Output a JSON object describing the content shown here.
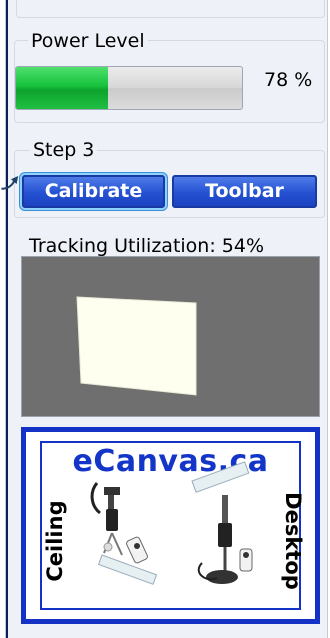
{
  "power": {
    "legend": "Power Level",
    "fraction": 0.78,
    "percent_text": "78 %"
  },
  "step3": {
    "legend": "Step 3",
    "calibrate_label": "Calibrate",
    "toolbar_label": "Toolbar"
  },
  "tracking": {
    "label": "Tracking Utilization: 54%",
    "utilization": 0.54
  },
  "logo": {
    "title": "eCanvas.ca",
    "left_word": "Ceiling",
    "right_word": "Desktop"
  },
  "colors": {
    "panel_bg": "#eef1f7",
    "button_blue": "#2451d2",
    "progress_green": "#16c23c",
    "tracking_bg": "#6f6f6f",
    "tracking_area": "#fffff0",
    "logo_blue": "#1432c6"
  }
}
